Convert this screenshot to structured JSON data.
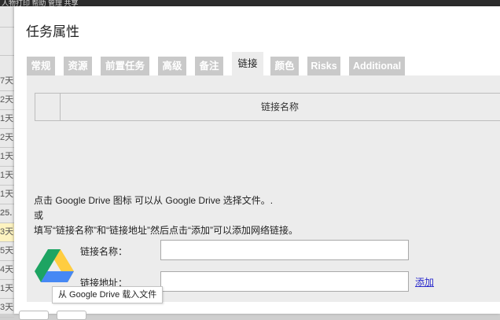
{
  "background_app": {
    "menu_text": "人物打印   帮助   管理    共享",
    "rows": [
      "7天",
      "2天",
      "1天",
      "2天",
      "1天",
      "1天",
      "1天",
      "25.",
      "3天",
      "5天",
      "4天",
      "1天",
      "3天"
    ]
  },
  "dialog": {
    "title": "任务属性",
    "tabs": [
      {
        "label": "常规"
      },
      {
        "label": "资源"
      },
      {
        "label": "前置任务"
      },
      {
        "label": "高级"
      },
      {
        "label": "备注"
      },
      {
        "label": "链接",
        "active": true
      },
      {
        "label": "颜色"
      },
      {
        "label": "Risks"
      },
      {
        "label": "Additional"
      }
    ],
    "links_table": {
      "columns": [
        "链接名称"
      ]
    },
    "info_lines": [
      "点击 Google Drive 图标 可以从 Google Drive 选择文件。.",
      "或",
      "填写“链接名称”和“链接地址”然后点击“添加”可以添加网络链接。"
    ],
    "gdrive_icon": "google-drive-icon",
    "form": {
      "name_label": "链接名称：",
      "name_value": "",
      "url_label": "链接地址：",
      "url_value": "",
      "add_label": "添加"
    },
    "tooltip": "从 Google Drive 载入文件"
  },
  "colors": {
    "tab_inactive": "#c9c9c9",
    "tab_active": "#ececec",
    "link": "#2b2bcc",
    "gdrive": [
      "#1da462",
      "#ffcd40",
      "#4688f4"
    ]
  }
}
